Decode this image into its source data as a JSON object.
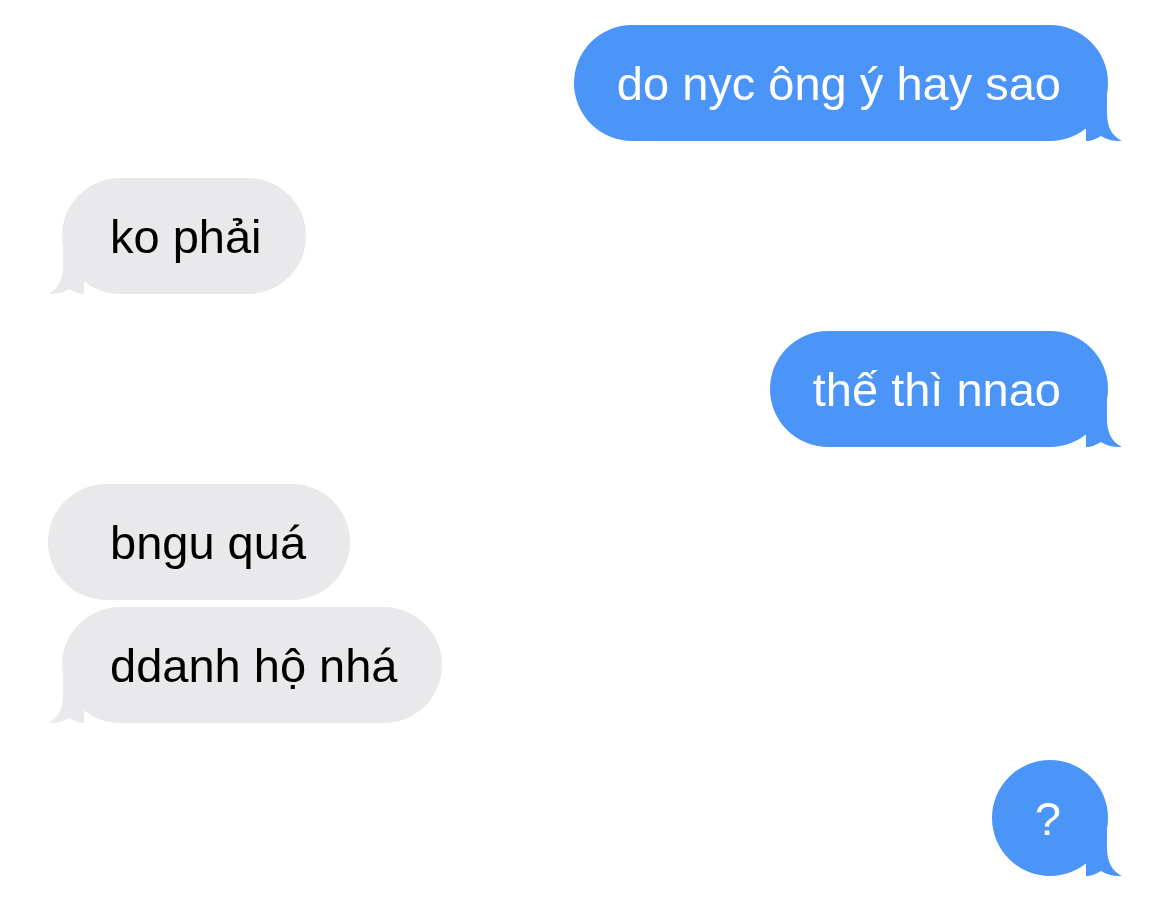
{
  "messages": [
    {
      "kind": "outgoing",
      "text": "do nyc ông ý hay sao"
    },
    {
      "kind": "incoming",
      "text": "ko phải"
    },
    {
      "kind": "outgoing",
      "text": "thế thì nnao"
    },
    {
      "kind": "incoming",
      "text": "bngu quá"
    },
    {
      "kind": "incoming",
      "text": "ddanh hộ nhá"
    },
    {
      "kind": "outgoing",
      "text": "?"
    }
  ]
}
